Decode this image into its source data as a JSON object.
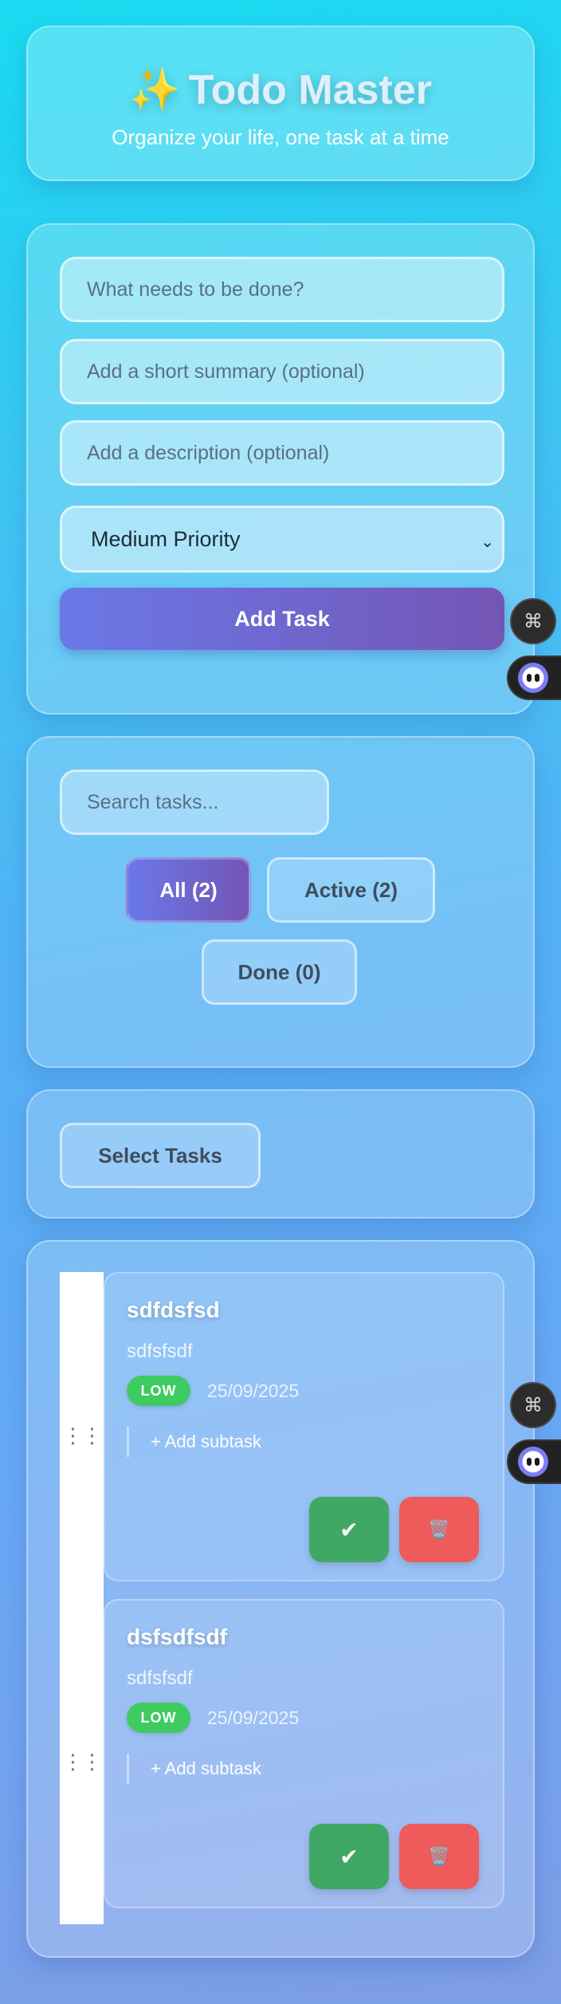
{
  "header": {
    "sparkle_icon": "✨",
    "title": "Todo Master",
    "subtitle": "Organize your life, one task at a time"
  },
  "form": {
    "title_placeholder": "What needs to be done?",
    "summary_placeholder": "Add a short summary (optional)",
    "description_placeholder": "Add a description (optional)",
    "priority_value": "Medium Priority",
    "add_label": "Add Task"
  },
  "filters": {
    "search_placeholder": "Search tasks...",
    "all_label": "All (2)",
    "active_label": "Active (2)",
    "done_label": "Done (0)"
  },
  "select": {
    "label": "Select Tasks"
  },
  "tasks": [
    {
      "title": "sdfdsfsd",
      "summary": "sdfsfsdf",
      "priority": "LOW",
      "date": "25/09/2025",
      "add_subtask": "+ Add subtask",
      "done_icon": "✔",
      "delete_icon": "🗑️"
    },
    {
      "title": "dsfsdfsdf",
      "summary": "sdfsfsdf",
      "priority": "LOW",
      "date": "25/09/2025",
      "add_subtask": "+ Add subtask",
      "done_icon": "✔",
      "delete_icon": "🗑️"
    }
  ],
  "widgets": {
    "grid_icon": "⌘",
    "handle_icon": "⋮⋮"
  },
  "colors": {
    "accent_start": "#6a79e8",
    "accent_end": "#7455b5",
    "low_badge": "#3ecb62",
    "done_button": "#3fa864",
    "delete_button": "#ef5a5a"
  }
}
